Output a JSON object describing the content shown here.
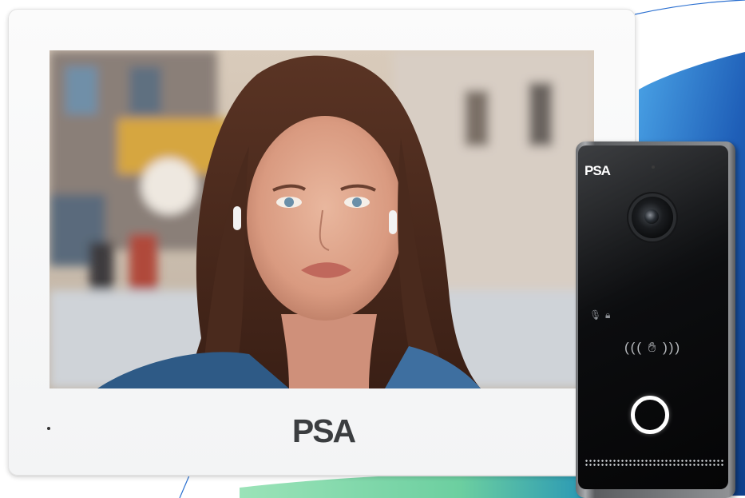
{
  "monitor": {
    "brand": "PSA"
  },
  "doorbell": {
    "brand": "PSA",
    "icons": {
      "mic": "microphone-icon",
      "lock": "lock-icon",
      "nfc": "nfc-card-icon",
      "call": "call-button-icon"
    }
  },
  "colors": {
    "accent_blue": "#1f5fb8",
    "accent_green": "#7fd8a2",
    "monitor_white": "#f7f7f7",
    "doorbell_black": "#0b0c0e"
  }
}
